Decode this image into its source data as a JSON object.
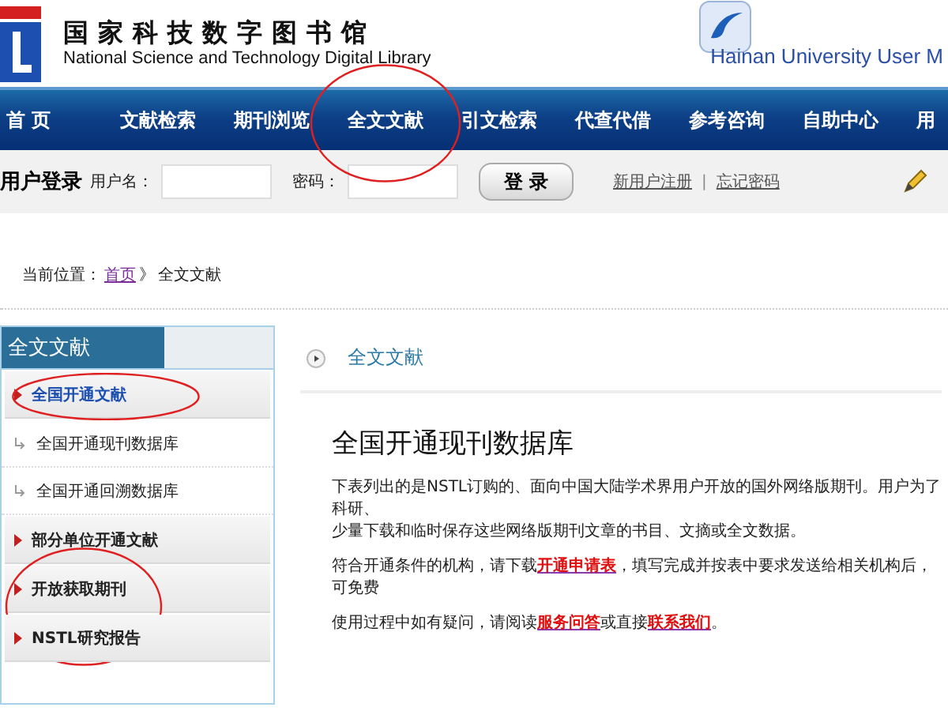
{
  "header": {
    "title": "国家科技数字图书馆",
    "subtitle": "National Science and Technology Digital Library",
    "partner": "Hainan University User M"
  },
  "nav": [
    {
      "label": "首 页",
      "circled": false
    },
    {
      "label": "文献检索",
      "circled": false
    },
    {
      "label": "期刊浏览",
      "circled": false
    },
    {
      "label": "全文文献",
      "circled": true
    },
    {
      "label": "引文检索",
      "circled": false
    },
    {
      "label": "代查代借",
      "circled": false
    },
    {
      "label": "参考咨询",
      "circled": false
    },
    {
      "label": "自助中心",
      "circled": false
    },
    {
      "label": "用",
      "circled": false
    }
  ],
  "login": {
    "title": "用户登录",
    "username_label": "用户名：",
    "password_label": "密码：",
    "button": "登 录",
    "links": [
      "新用户注册",
      "忘记密码"
    ],
    "separator": "|"
  },
  "breadcrumb": {
    "label": "当前位置：",
    "home": "首页",
    "separator": "》",
    "current": "全文文献"
  },
  "sidebar": {
    "title": "全文文献",
    "items": [
      {
        "label": "全国开通文献",
        "kind": "section",
        "selected": true,
        "circled": true
      },
      {
        "label": "全国开通现刊数据库",
        "kind": "sub",
        "selected": false,
        "circled": false
      },
      {
        "label": "全国开通回溯数据库",
        "kind": "sub",
        "selected": false,
        "circled": false
      },
      {
        "label": "部分单位开通文献",
        "kind": "section",
        "selected": false,
        "circled": false
      },
      {
        "label": "开放获取期刊",
        "kind": "section",
        "selected": false,
        "circled": true
      },
      {
        "label": "NSTL研究报告",
        "kind": "section",
        "selected": false,
        "circled": false
      }
    ]
  },
  "content": {
    "heading": "全文文献",
    "title": "全国开通现刊数据库",
    "paragraphs": [
      [
        {
          "text": "下表列出的是NSTL订购的、面向中国大陆学术界用户开放的国外网络版期刊。用户为了科研、",
          "kind": "text"
        }
      ],
      [
        {
          "text": "少量下载和临时保存这些网络版期刊文章的书目、文摘或全文数据。",
          "kind": "text"
        }
      ],
      [
        {
          "text": "符合开通条件的机构，请下载",
          "kind": "text"
        },
        {
          "text": "开通申请表",
          "kind": "link"
        },
        {
          "text": "，填写完成并按表中要求发送给相关机构后，可免费",
          "kind": "text"
        }
      ],
      [
        {
          "text": "使用过程中如有疑问，请阅读",
          "kind": "text"
        },
        {
          "text": "服务问答",
          "kind": "link"
        },
        {
          "text": "或直接",
          "kind": "text"
        },
        {
          "text": "联系我们",
          "kind": "link"
        },
        {
          "text": "。",
          "kind": "text"
        }
      ]
    ]
  }
}
